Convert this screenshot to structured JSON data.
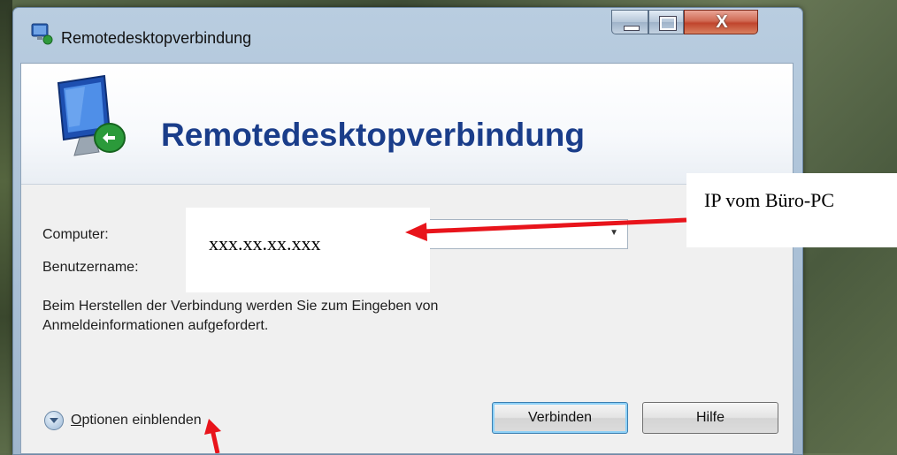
{
  "window": {
    "title": "Remotedesktopverbindung",
    "close_glyph": "X"
  },
  "banner": {
    "title": "Remotedesktopverbindung",
    "icon": "remote-desktop-monitor-icon"
  },
  "form": {
    "computer_label": "Computer:",
    "computer_value": "xxx.xx.xx.xxx",
    "username_label": "Benutzername:",
    "info_text_line1": "Beim Herstellen der Verbindung werden Sie zum Eingeben von",
    "info_text_line2": "Anmeldeinformationen aufgefordert."
  },
  "options": {
    "mnemonic": "O",
    "label_rest": "ptionen einblenden"
  },
  "buttons": {
    "connect_label": "Verbinden",
    "help_label": "Hilfe"
  },
  "annotation": {
    "text": "IP vom Büro-PC",
    "arrow_color": "#e8141b"
  },
  "colors": {
    "banner_title": "#1a3d8a",
    "close_button": "#c0452d"
  }
}
